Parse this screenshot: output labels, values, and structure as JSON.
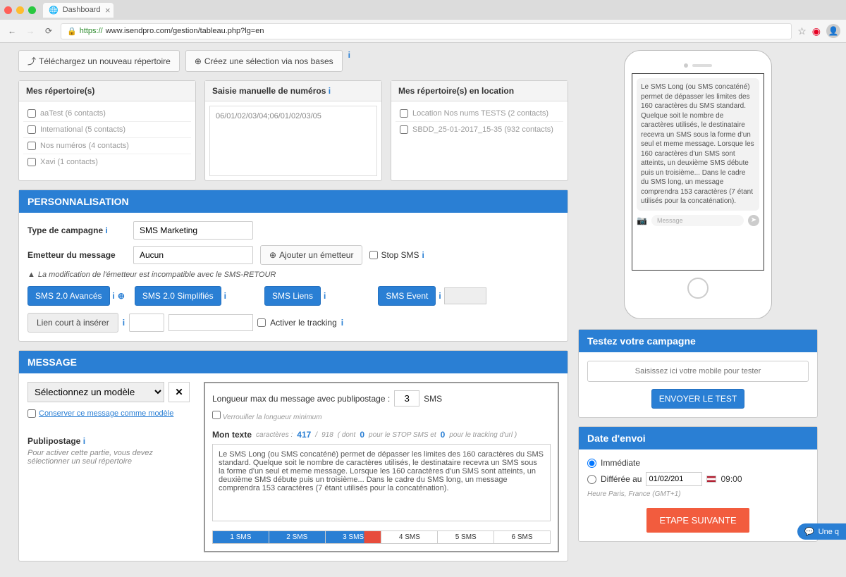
{
  "browser": {
    "tab_title": "Dashboard",
    "url_https": "https://",
    "url_rest": "www.isendpro.com/gestion/tableau.php?lg=en"
  },
  "top": {
    "upload_button": "Téléchargez un nouveau répertoire",
    "create_selection_button": "Créez une sélection via nos bases"
  },
  "repos": {
    "mine_title": "Mes répertoire(s)",
    "manual_title": "Saisie manuelle de numéros",
    "rented_title": "Mes répertoire(s) en location",
    "mine_items": [
      "aaTest (6 contacts)",
      "International (5 contacts)",
      "Nos numéros (4 contacts)",
      "Xavi (1 contacts)"
    ],
    "manual_value": "06/01/02/03/04;06/01/02/03/05",
    "rented_items": [
      "Location Nos nums TESTS (2 contacts)",
      "SBDD_25-01-2017_15-35 (932 contacts)"
    ]
  },
  "perso": {
    "title": "PERSONNALISATION",
    "type_label": "Type de campagne",
    "type_value": "SMS Marketing",
    "sender_label": "Emetteur du message",
    "sender_value": "Aucun",
    "add_sender_button": "Ajouter un émetteur",
    "stop_sms": "Stop SMS",
    "warning": "La modification de l'émetteur est incompatible avec le SMS-RETOUR",
    "sms20_adv": "SMS 2.0 Avancés",
    "sms20_simp": "SMS 2.0 Simplifiés",
    "sms_links": "SMS Liens",
    "sms_event": "SMS Event",
    "short_link": "Lien court à insérer",
    "enable_tracking": "Activer le tracking"
  },
  "message": {
    "title": "MESSAGE",
    "model_placeholder": "Sélectionnez un modèle",
    "save_model": "Conserver ce message comme modèle",
    "publipostage": "Publipostage",
    "publi_desc": "Pour activer cette partie, vous devez sélectionner un seul répertoire",
    "length_label": "Longueur max du message avec publipostage :",
    "length_value": "3",
    "length_unit": "SMS",
    "lock_min": "Verrouiller la longueur minimum",
    "my_text_label": "Mon texte",
    "chars_label": "caractères :",
    "chars_used": "417",
    "chars_sep": "/",
    "chars_max": "918",
    "dont": "( dont",
    "zero1": "0",
    "stop_for": "pour le STOP SMS et",
    "zero2": "0",
    "track_for": "pour le tracking d'url )",
    "sms_text": "Le SMS Long (ou SMS concaténé) permet de dépasser les limites des 160 caractères du SMS standard. Quelque soit le nombre de caractères utilisés, le destinataire recevra un SMS sous la forme d'un seul et meme message. Lorsque les 160 caractères d'un SMS sont atteints, un deuxième SMS débute puis un troisième... Dans le cadre du SMS long, un message comprendra 153 caractères (7 étant utilisés pour la concaténation).",
    "segments": [
      "1 SMS",
      "2 SMS",
      "3 SMS",
      "4 SMS",
      "5 SMS",
      "6 SMS"
    ]
  },
  "phone_preview": {
    "msg": "Le SMS Long (ou SMS concaténé) permet de dépasser les limites des 160 caractères du SMS standard. Quelque soit le nombre de caractères utilisés, le destinataire recevra un SMS sous la forme d'un seul et meme message. Lorsque les 160 caractères d'un SMS sont atteints, un deuxième SMS débute puis un troisième... Dans le cadre du SMS long, un message comprendra 153 caractères (7 étant utilisés pour la concaténation).",
    "placeholder": "Message"
  },
  "test": {
    "title": "Testez votre campagne",
    "placeholder": "Saisissez ici votre mobile pour tester",
    "send_button": "ENVOYER LE TEST"
  },
  "date": {
    "title": "Date d'envoi",
    "immediate": "Immédiate",
    "deferred": "Différée au",
    "date_value": "01/02/201",
    "time_value": "09:00",
    "tz": "Heure Paris, France (GMT+1)",
    "next_button": "ETAPE SUIVANTE"
  },
  "chat": "Une q"
}
